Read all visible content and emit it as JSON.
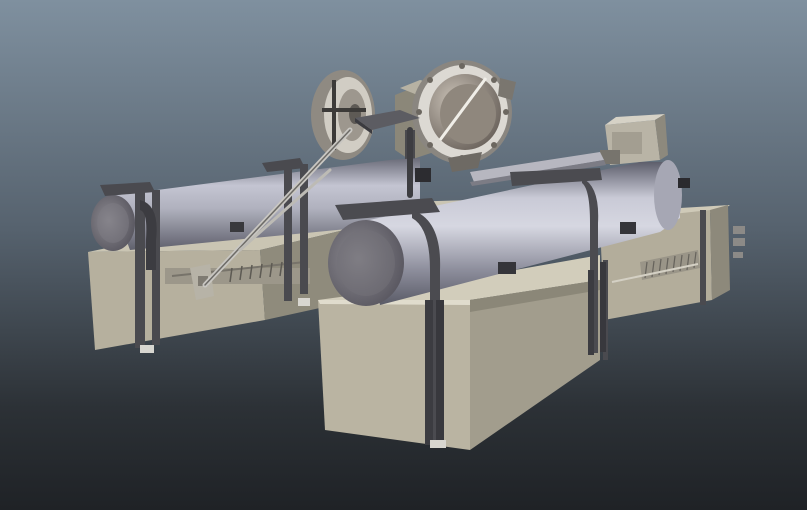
{
  "scene": {
    "type": "3d-model-viewport",
    "subject": "twin-cylinder-launcher-assembly",
    "components": [
      "back-cylinder",
      "front-cylinder",
      "back-base-box",
      "front-base-box",
      "side-base-box",
      "front-disc-wheel",
      "rear-disc-wheel",
      "control-box",
      "diagonal-struts",
      "cylinder-brackets"
    ],
    "colors": {
      "background_top": "#7f909f",
      "background_mid": "#56626e",
      "background_bottom": "#1f2226",
      "box_face": "#b7b19f",
      "box_top": "#cdc8b6",
      "box_side": "#8e8a7b",
      "cylinder_light": "#d2d3dd",
      "cylinder_dark": "#6e6f7d",
      "metal_dark": "#444447",
      "disc_light": "#d9d6cf"
    }
  }
}
